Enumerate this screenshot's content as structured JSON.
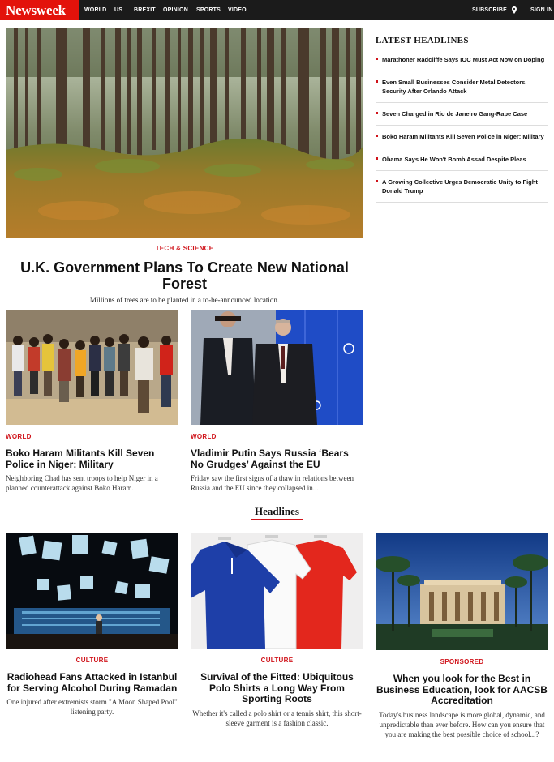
{
  "brand": {
    "logo": "Newsweek",
    "accent": "#e3120b",
    "nav_bg": "#1b1b1b"
  },
  "nav": {
    "items": [
      "WORLD",
      "US",
      "BREXIT",
      "OPINION",
      "SPORTS",
      "VIDEO"
    ],
    "subscribe": "SUBSCRIBE",
    "location_icon": "map-pin-icon",
    "signin": "SIGN IN"
  },
  "hero": {
    "image": "forest-pine-trees-ferns-photo",
    "kicker": "TECH & SCIENCE",
    "title": "U.K. Government Plans To Create New National Forest",
    "dek": "Millions of trees are to be planted in a to-be-announced location."
  },
  "cards_row1": [
    {
      "image": "crowd-of-people-photo",
      "kicker": "WORLD",
      "title": "Boko Haram Militants Kill Seven Police in Niger: Military",
      "dek": "Neighboring Chad has sent troops to help Niger in a planned counterattack against Boko Haram."
    },
    {
      "image": "two-men-in-suits-photo",
      "kicker": "WORLD",
      "title": "Vladimir Putin Says Russia ‘Bears No Grudges’ Against the EU",
      "dek": "Friday saw the first signs of a thaw in relations between Russia and the EU since they collapsed in..."
    }
  ],
  "section": {
    "title": "Headlines"
  },
  "cards_row2": [
    {
      "image": "concert-stage-photo",
      "kicker": "CULTURE",
      "title": "Radiohead Fans Attacked in Istanbul for Serving Alcohol During Ramadan",
      "dek": "One injured after extremists storm \"A Moon Shaped Pool\" listening party."
    },
    {
      "image": "polo-shirts-photo",
      "kicker": "CULTURE",
      "title": "Survival of the Fitted: Ubiquitous Polo Shirts a Long Way From Sporting Roots",
      "dek": "Whether it's called a polo shirt or a tennis shirt, this short-sleeve garment is a fashion classic."
    },
    {
      "image": "palace-with-palm-trees-photo",
      "kicker": "SPONSORED",
      "title": "When you look for the Best in Business Education, look for AACSB Accreditation",
      "dek": "Today's business landscape is more global, dynamic, and unpredictable than ever before. How can you ensure that you are making the best possible choice of school...?"
    }
  ],
  "sidebar": {
    "title": "LATEST HEADLINES",
    "items": [
      "Marathoner Radcliffe Says IOC Must Act Now on Doping",
      "Even Small Businesses Consider Metal Detectors, Security After Orlando Attack",
      "Seven Charged in Rio de Janeiro Gang-Rape Case",
      "Boko Haram Militants Kill Seven Police in Niger: Military",
      "Obama Says He Won't Bomb Assad Despite Pleas",
      "A Growing Collective Urges Democratic Unity to Fight Donald Trump"
    ]
  }
}
